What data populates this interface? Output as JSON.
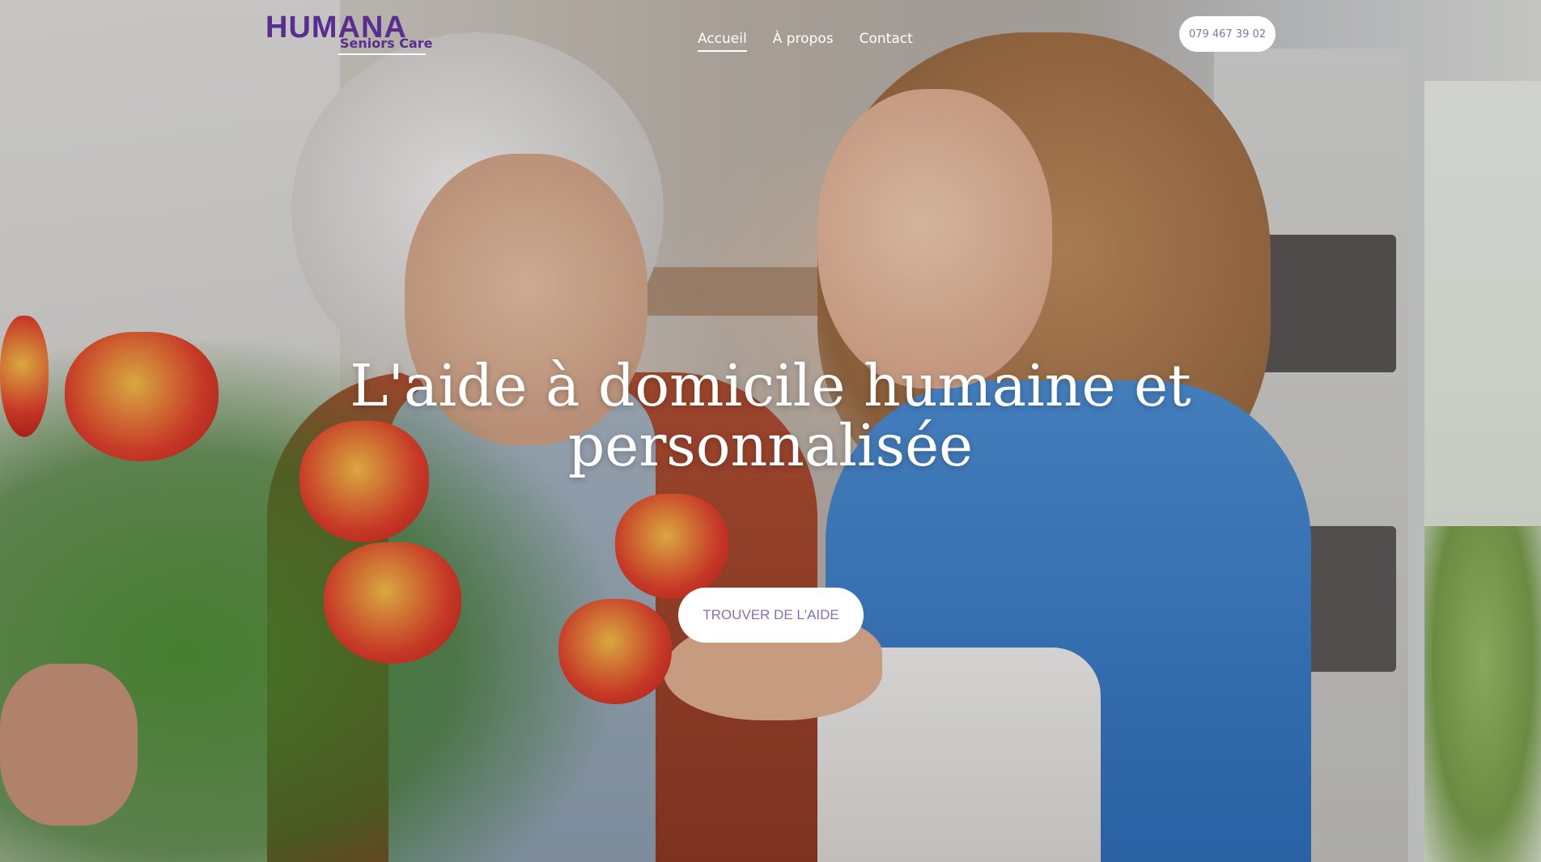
{
  "brand": {
    "name": "HUMANA",
    "tagline": "Seniors Care",
    "color": "#5a2d91"
  },
  "nav": {
    "items": [
      {
        "label": "Accueil",
        "active": true
      },
      {
        "label": "À propos",
        "active": false
      },
      {
        "label": "Contact",
        "active": false
      }
    ]
  },
  "header": {
    "phone_label": "079 467 39 02"
  },
  "hero": {
    "title_line1": "L'aide à domicile humaine et",
    "title_line2": "personnalisée",
    "cta_label": "TROUVER DE L'AIDE",
    "cta_text_color": "#8a6fb2"
  }
}
